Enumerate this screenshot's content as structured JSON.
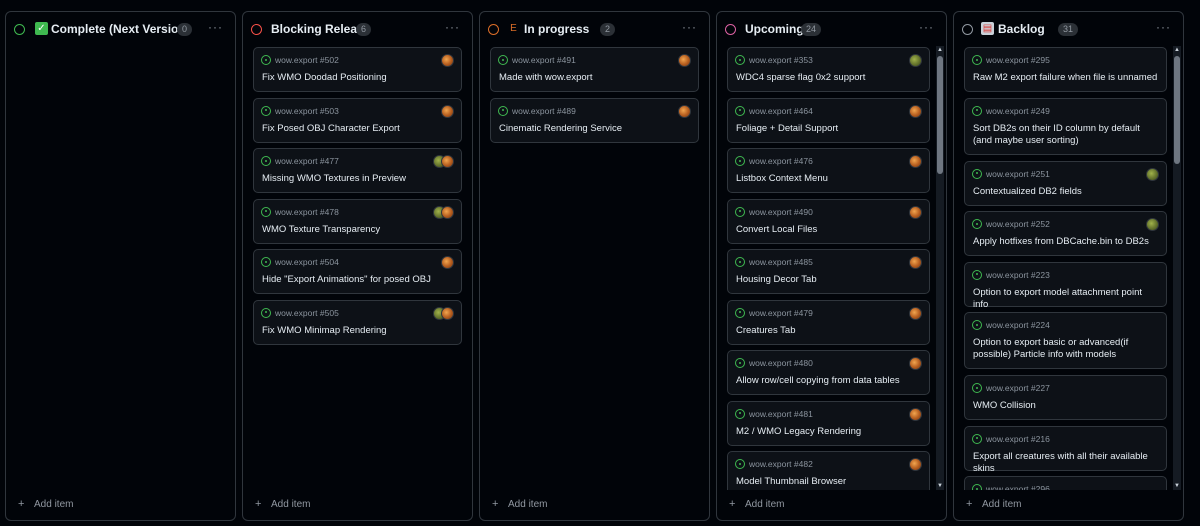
{
  "columns": [
    {
      "title": "Complete (Next Version)",
      "count": "0",
      "emoji_icon": "check-box-emoji",
      "status_color": "#3fb950",
      "cards": []
    },
    {
      "title": "Blocking Release",
      "count": "6",
      "emoji_icon": "",
      "status_color": "#f85149",
      "cards": [
        {
          "ref": "wow.export #502",
          "title": "Fix WMO Doodad Positioning",
          "assignees": 1
        },
        {
          "ref": "wow.export #503",
          "title": "Fix Posed OBJ Character Export",
          "assignees": 1
        },
        {
          "ref": "wow.export #477",
          "title": "Missing WMO Textures in Preview",
          "assignees": 2
        },
        {
          "ref": "wow.export #478",
          "title": "WMO Texture Transparency",
          "assignees": 2
        },
        {
          "ref": "wow.export #504",
          "title": "Hide \"Export Animations\" for posed OBJ",
          "assignees": 1
        },
        {
          "ref": "wow.export #505",
          "title": "Fix WMO Minimap Rendering",
          "assignees": 2
        }
      ]
    },
    {
      "title": "In progress",
      "count": "2",
      "emoji_icon": "letter-e-emoji",
      "status_color": "#db6d28",
      "cards": [
        {
          "ref": "wow.export #491",
          "title": "Made with wow.export",
          "assignees": 1
        },
        {
          "ref": "wow.export #489",
          "title": "Cinematic Rendering Service",
          "assignees": 1
        }
      ]
    },
    {
      "title": "Upcoming",
      "count": "24",
      "emoji_icon": "",
      "status_color": "#db61a2",
      "cards": [
        {
          "ref": "wow.export #353",
          "title": "WDC4 sparse flag 0x2 support",
          "assignees": 1,
          "avatar_style": "green"
        },
        {
          "ref": "wow.export #464",
          "title": "Foliage + Detail Support",
          "assignees": 1
        },
        {
          "ref": "wow.export #476",
          "title": "Listbox Context Menu",
          "assignees": 1
        },
        {
          "ref": "wow.export #490",
          "title": "Convert Local Files",
          "assignees": 1
        },
        {
          "ref": "wow.export #485",
          "title": "Housing Decor Tab",
          "assignees": 1
        },
        {
          "ref": "wow.export #479",
          "title": "Creatures Tab",
          "assignees": 1
        },
        {
          "ref": "wow.export #480",
          "title": "Allow row/cell copying from data tables",
          "assignees": 1
        },
        {
          "ref": "wow.export #481",
          "title": "M2 / WMO Legacy Rendering",
          "assignees": 1
        },
        {
          "ref": "wow.export #482",
          "title": "Model Thumbnail Browser",
          "assignees": 1
        }
      ]
    },
    {
      "title": "Backlog",
      "count": "31",
      "emoji_icon": "clipboard-emoji",
      "status_color": "#9198a1",
      "cards": [
        {
          "ref": "wow.export #295",
          "title": "Raw M2 export failure when file is unnamed",
          "assignees": 0
        },
        {
          "ref": "wow.export #249",
          "title": "Sort DB2s on their ID column by default (and maybe user sorting)",
          "assignees": 0
        },
        {
          "ref": "wow.export #251",
          "title": "Contextualized DB2 fields",
          "assignees": 1,
          "avatar_style": "green"
        },
        {
          "ref": "wow.export #252",
          "title": "Apply hotfixes from DBCache.bin to DB2s",
          "assignees": 1,
          "avatar_style": "green"
        },
        {
          "ref": "wow.export #223",
          "title": "Option to export model attachment point info",
          "assignees": 0
        },
        {
          "ref": "wow.export #224",
          "title": "Option to export basic or advanced(if possible) Particle info with models",
          "assignees": 0
        },
        {
          "ref": "wow.export #227",
          "title": "WMO Collision",
          "assignees": 0
        },
        {
          "ref": "wow.export #216",
          "title": "Export all creatures with all their available skins",
          "assignees": 0
        },
        {
          "ref": "wow.export #296",
          "title": "",
          "assignees": 0
        }
      ]
    }
  ],
  "add_item_label": "Add item",
  "menu_glyph": "···",
  "add_glyph": "+",
  "colors": {
    "background": "#010409",
    "card": "#0d1117",
    "border": "#30363d",
    "issue_open": "#3fb950"
  }
}
